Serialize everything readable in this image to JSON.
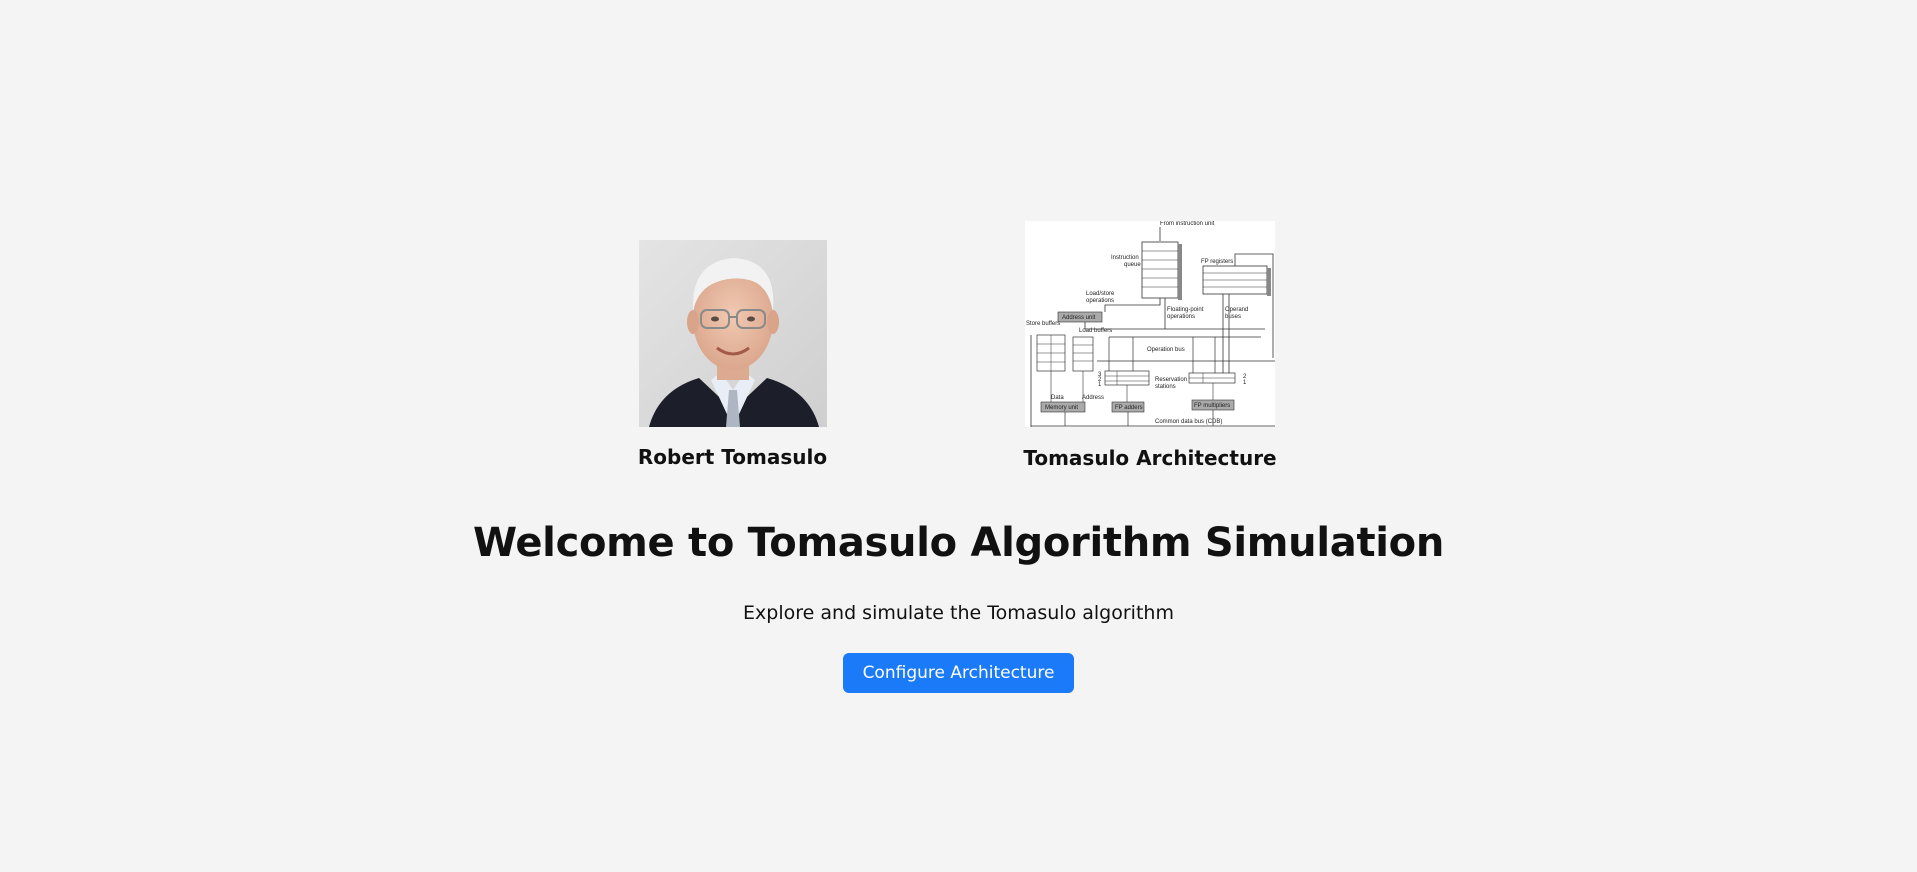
{
  "figures": [
    {
      "caption": "Robert Tomasulo",
      "image": "portrait-photo"
    },
    {
      "caption": "Tomasulo Architecture",
      "image": "architecture-diagram",
      "diagram_labels": {
        "from_instruction_unit": "From instruction unit",
        "instruction_queue_1": "Instruction",
        "instruction_queue_2": "queue",
        "fp_registers": "FP registers",
        "load_store_1": "Load/store",
        "load_store_2": "operations",
        "address_unit": "Address unit",
        "store_buffers": "Store buffers",
        "load_buffers": "Load buffers",
        "fp_ops_1": "Floating-point",
        "fp_ops_2": "operations",
        "operand_buses_1": "Operand",
        "operand_buses_2": "buses",
        "operation_bus": "Operation bus",
        "reservation_1": "Reservation",
        "reservation_2": "stations",
        "data": "Data",
        "address": "Address",
        "memory_unit": "Memory unit",
        "fp_adders": "FP adders",
        "fp_multipliers": "FP multipliers",
        "cdb": "Common data bus (CDB)",
        "rs_num_3": "3",
        "rs_num_2": "2",
        "rs_num_1": "1",
        "rs_mul_2": "2",
        "rs_mul_1": "1"
      }
    }
  ],
  "hero": {
    "title": "Welcome to Tomasulo Algorithm Simulation",
    "subtitle": "Explore and simulate the Tomasulo algorithm",
    "cta_label": "Configure Architecture"
  },
  "colors": {
    "background": "#f4f4f4",
    "button": "#1a7af8",
    "button_text": "#ffffff"
  }
}
